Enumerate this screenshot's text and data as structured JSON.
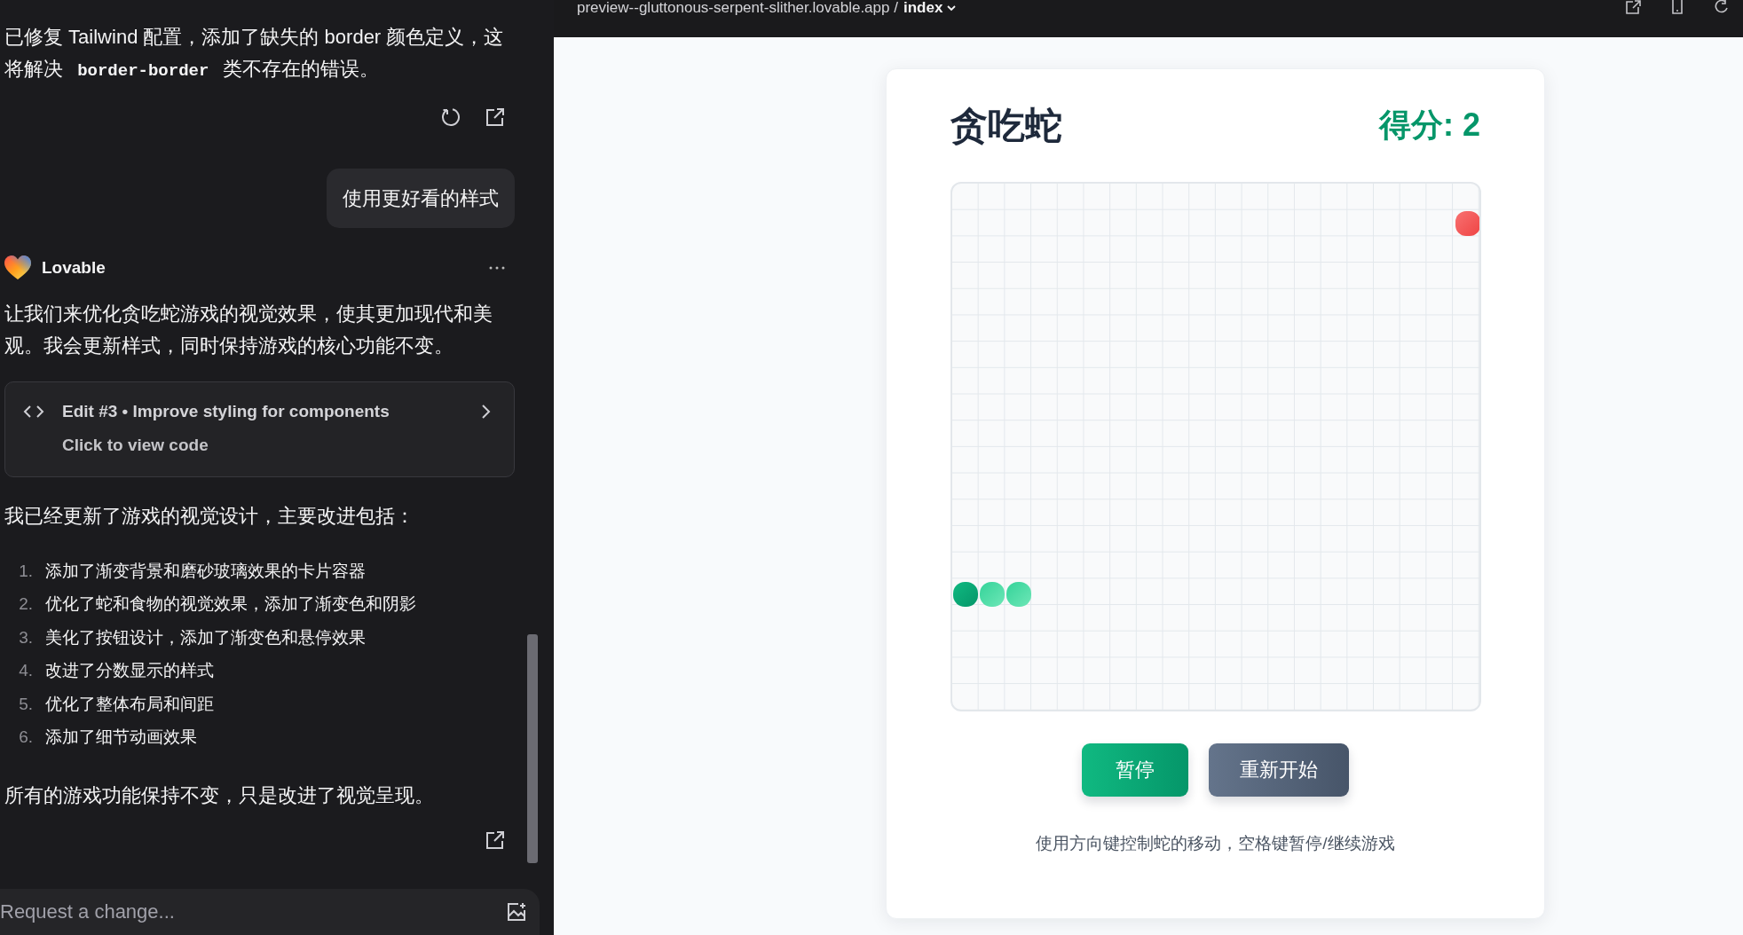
{
  "chat": {
    "fix_message": [
      {
        "kind": "text",
        "text": "已修复 Tailwind 配置，添加了缺失的 border 颜色定义，这将解决 "
      },
      {
        "kind": "code",
        "text": "border-border"
      },
      {
        "kind": "text",
        "text": " 类不存在的错误。"
      }
    ],
    "user_message": "使用更好看的样式",
    "assistant": {
      "name": "Lovable",
      "intro": "让我们来优化贪吃蛇游戏的视觉效果，使其更加现代和美观。我会更新样式，同时保持游戏的核心功能不变。",
      "edit_card": {
        "title": "Edit #3 • Improve styling for components",
        "subtitle": "Click to view code"
      },
      "summary": "我已经更新了游戏的视觉设计，主要改进包括：",
      "list": [
        {
          "number": "1.",
          "text": "添加了渐变背景和磨砂玻璃效果的卡片容器"
        },
        {
          "number": "2.",
          "text": "优化了蛇和食物的视觉效果，添加了渐变色和阴影"
        },
        {
          "number": "3.",
          "text": "美化了按钮设计，添加了渐变色和悬停效果"
        },
        {
          "number": "4.",
          "text": "改进了分数显示的样式"
        },
        {
          "number": "5.",
          "text": "优化了整体布局和间距"
        },
        {
          "number": "6.",
          "text": "添加了细节动画效果"
        }
      ],
      "closing": "所有的游戏功能保持不变，只是改进了视觉呈现。"
    },
    "input": {
      "placeholder": "Request a change..."
    }
  },
  "preview": {
    "url": "preview--gluttonous-serpent-slither.lovable.app",
    "separator": "/",
    "page": "index"
  },
  "game": {
    "title": "贪吃蛇",
    "score": "得分: 2",
    "buttons": [
      {
        "kind": "primary",
        "label": "暂停"
      },
      {
        "kind": "secondary",
        "label": "重新开始"
      }
    ],
    "hint": "使用方向键控制蛇的移动，空格键暂停/继续游戏"
  }
}
